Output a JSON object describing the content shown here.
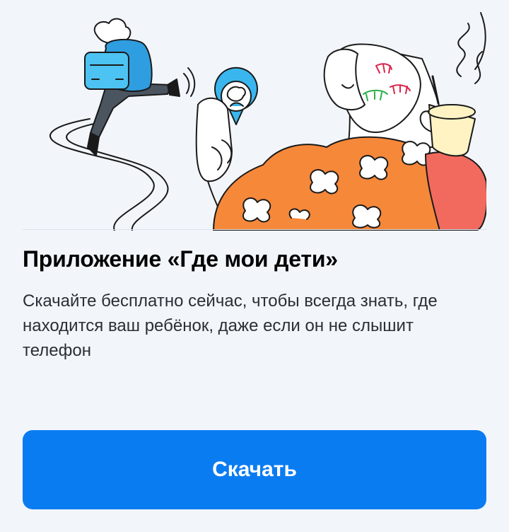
{
  "promo": {
    "title": "Приложение «Где мои дети»",
    "description": "Скачайте бесплатно сейчас, чтобы всегда знать, где находится ваш ребёнок, даже если он не слышит телефон",
    "download_label": "Скачать"
  },
  "colors": {
    "accent": "#0a7cf2",
    "background": "#f2f6fb",
    "sweater": "#f6883a",
    "backpack": "#3ab6ee",
    "pillow": "#f26a5e"
  },
  "illustration": {
    "icons": [
      "child-with-backpack-icon",
      "location-pin-icon",
      "woman-with-phone-icon",
      "tea-cup-icon"
    ]
  }
}
